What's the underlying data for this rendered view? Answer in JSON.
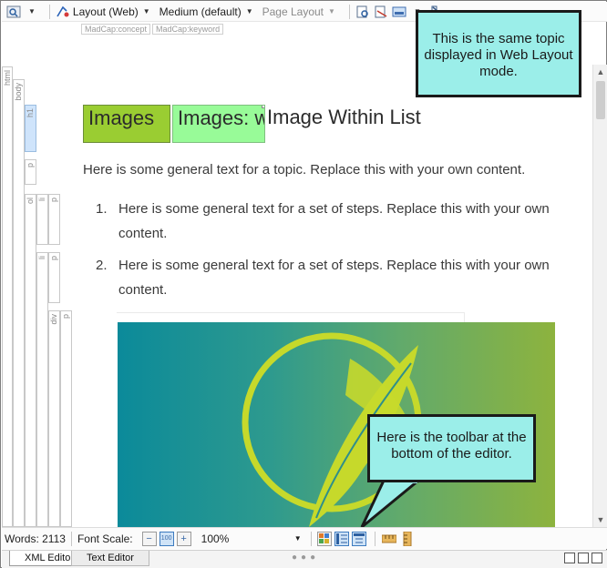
{
  "toolbar": {
    "layout_label": "Layout (Web)",
    "medium_label": "Medium (default)",
    "page_layout_label": "Page Layout"
  },
  "tags": [
    "MadCap:concept",
    "MadCap:keyword"
  ],
  "structure_labels": {
    "html": "html",
    "body": "body",
    "h1": "h1",
    "p1": "p",
    "ol": "ol",
    "li1": "li",
    "p2": "p",
    "li2": "li",
    "div": "div",
    "p3": "p"
  },
  "topic": {
    "heading_block_1": "Images",
    "heading_block_2": "Images: within",
    "heading_text": "Image Within List",
    "intro": "Here is some general text for a topic. Replace this with your own content.",
    "steps": [
      {
        "num": "1.",
        "text": "Here is some general text for a set of steps. Replace this with your own content."
      },
      {
        "num": "2.",
        "text": "Here is some general text for a set of steps. Replace this with your own content."
      }
    ]
  },
  "callouts": {
    "top": "This is the same topic displayed in Web Layout mode.",
    "bottom": "Here is the toolbar at the bottom of the editor."
  },
  "statusbar": {
    "words": "Words: 2113",
    "font_scale_label": "Font Scale:",
    "zoom_value": "100%"
  },
  "editor_tabs": {
    "xml": "XML Editor",
    "text": "Text Editor"
  },
  "colors": {
    "callout_fill": "#9beee9",
    "heading_block_1": "#9acd32",
    "heading_block_2": "#98fb98",
    "hero_gradient_start": "#0b8a9a",
    "hero_gradient_end": "#8db33e",
    "feather": "#c6d92b"
  }
}
